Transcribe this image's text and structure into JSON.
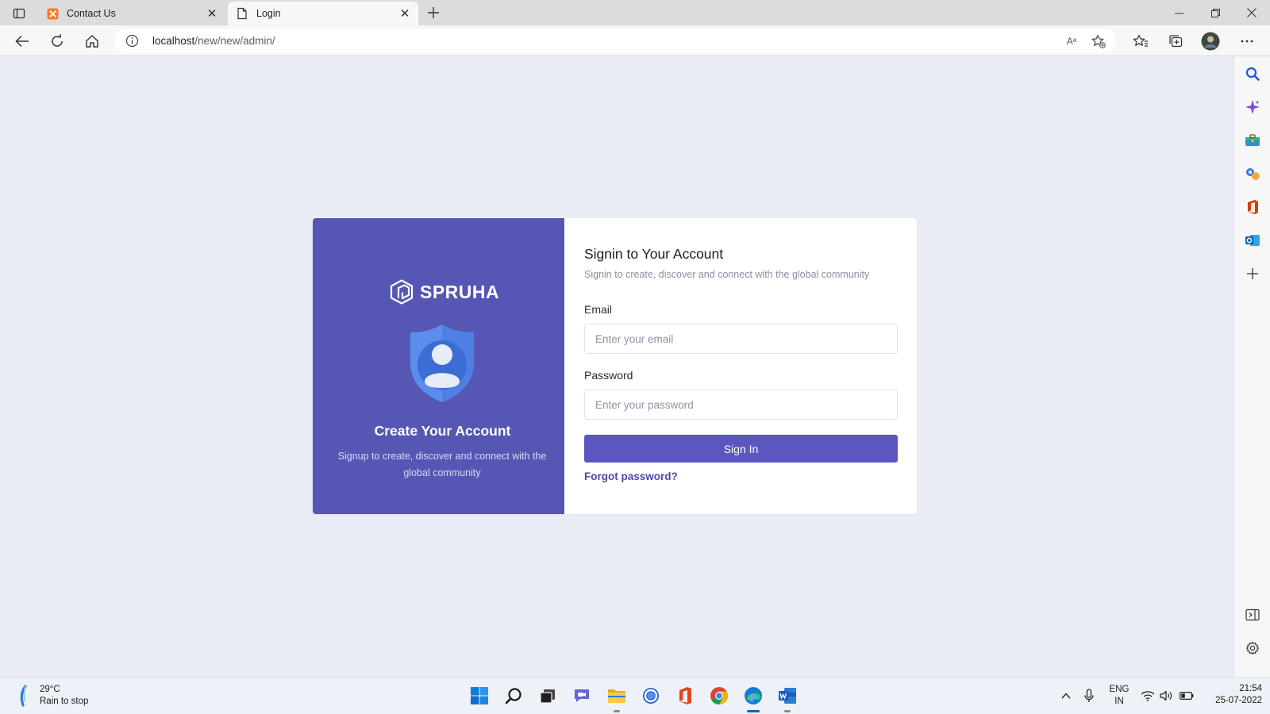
{
  "browser": {
    "tabs": [
      {
        "title": "Contact Us",
        "active": false,
        "favicon": "xampp-icon"
      },
      {
        "title": "Login",
        "active": true,
        "favicon": "page-icon"
      }
    ],
    "address": {
      "host": "localhost",
      "path": "/new/new/admin/"
    },
    "read_aloud_label": "Aᵃ"
  },
  "card": {
    "left": {
      "brand": "SPRUHA",
      "title": "Create Your Account",
      "subtitle": "Signup to create, discover and connect with the global community",
      "bg_color": "#5656b4"
    },
    "right": {
      "title": "Signin to Your Account",
      "subtitle": "Signin to create, discover and connect with the global community",
      "email_label": "Email",
      "email_placeholder": "Enter your email",
      "password_label": "Password",
      "password_placeholder": "Enter your password",
      "signin_label": "Sign In",
      "forgot_label": "Forgot password?",
      "accent_color": "#5c56c0"
    }
  },
  "taskbar": {
    "weather": {
      "temp": "29°C",
      "condition": "Rain to stop"
    },
    "lang": {
      "line1": "ENG",
      "line2": "IN"
    },
    "clock": {
      "time": "21:54",
      "date": "25-07-2022"
    }
  }
}
